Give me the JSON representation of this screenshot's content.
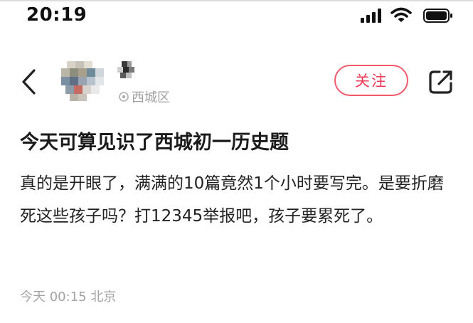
{
  "status_bar": {
    "time": "20:19",
    "icons": [
      "signal-icon",
      "wifi-icon",
      "battery-icon"
    ]
  },
  "header": {
    "back_icon": "chevron-left-icon",
    "location": "西城区",
    "location_icon": "location-pin-icon",
    "follow_label": "关注",
    "share_icon": "share-icon"
  },
  "post": {
    "title": "今天可算见识了西城初一历史题",
    "body": "真的是开眼了，满满的10篇竟然1个小时要写完。是要折磨死这些孩子吗？打12345举报吧，孩子要累死了。",
    "meta": "今天 00:15 北京"
  },
  "colors": {
    "accent": "#ee3a54",
    "text_primary": "#1a1a1a",
    "text_secondary": "#a3a3a3"
  }
}
